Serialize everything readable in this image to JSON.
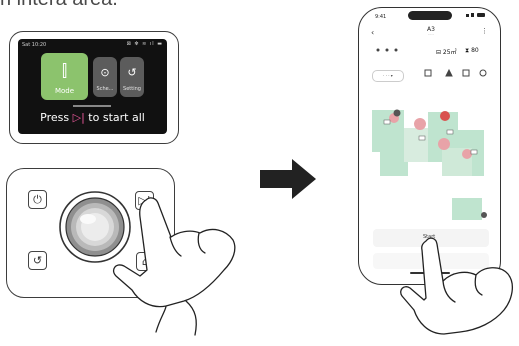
{
  "caption": "n intera area.",
  "device_screen": {
    "status_time": "Sat 10:20",
    "status_icons": "⊠ ✻ ≋ ıl ▬",
    "tiles": [
      {
        "label": "Mode",
        "glyph": "⫿"
      },
      {
        "label": "Sche...",
        "glyph": "⊙"
      },
      {
        "label": "Setting",
        "glyph": "↺"
      }
    ],
    "press_prefix": "Press ",
    "press_icon": "▷|",
    "press_suffix": " to start all"
  },
  "remote": {
    "power_glyph": "⏻",
    "play_glyph": "▷|",
    "dock_glyph": "↺",
    "home_glyph": "⌂"
  },
  "phone": {
    "time": "9:41",
    "title": "A3",
    "subtitle": "·····",
    "back": "‹",
    "more": "⋮",
    "area": "⊟ 25㎡",
    "duration": "⧗ 80",
    "map_select": "· · · ▾",
    "start_label": "Start",
    "colors": {
      "room_green": "#bfe4cf",
      "room_pink": "#e8a3a8",
      "room_red": "#d9534f"
    }
  }
}
